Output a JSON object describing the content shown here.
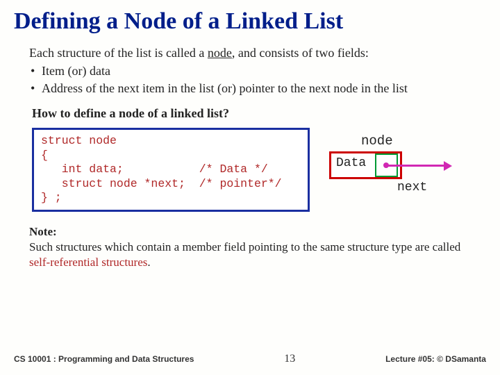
{
  "title": "Defining a Node of a Linked List",
  "intro_prefix": "Each structure of the list is called a ",
  "intro_node": "node",
  "intro_suffix": ", and consists of two fields:",
  "bullets": [
    "Item (or) data",
    "Address of the next item in the list (or) pointer to the next node in the list"
  ],
  "subhead": "How to define a node of a linked list?",
  "code": "struct node\n{\n   int data;           /* Data */\n   struct node *next;  /* pointer*/\n} ;",
  "diagram": {
    "node_label": "node",
    "data_label": "Data",
    "next_label": "next"
  },
  "note": {
    "label": "Note:",
    "text_prefix": "Such structures which contain a member field pointing to the same structure type are called ",
    "self_ref": "self-referential structures",
    "text_suffix": "."
  },
  "footer": {
    "left": "CS 10001 : Programming and Data Structures",
    "center": "13",
    "right": "Lecture #05: © DSamanta"
  }
}
